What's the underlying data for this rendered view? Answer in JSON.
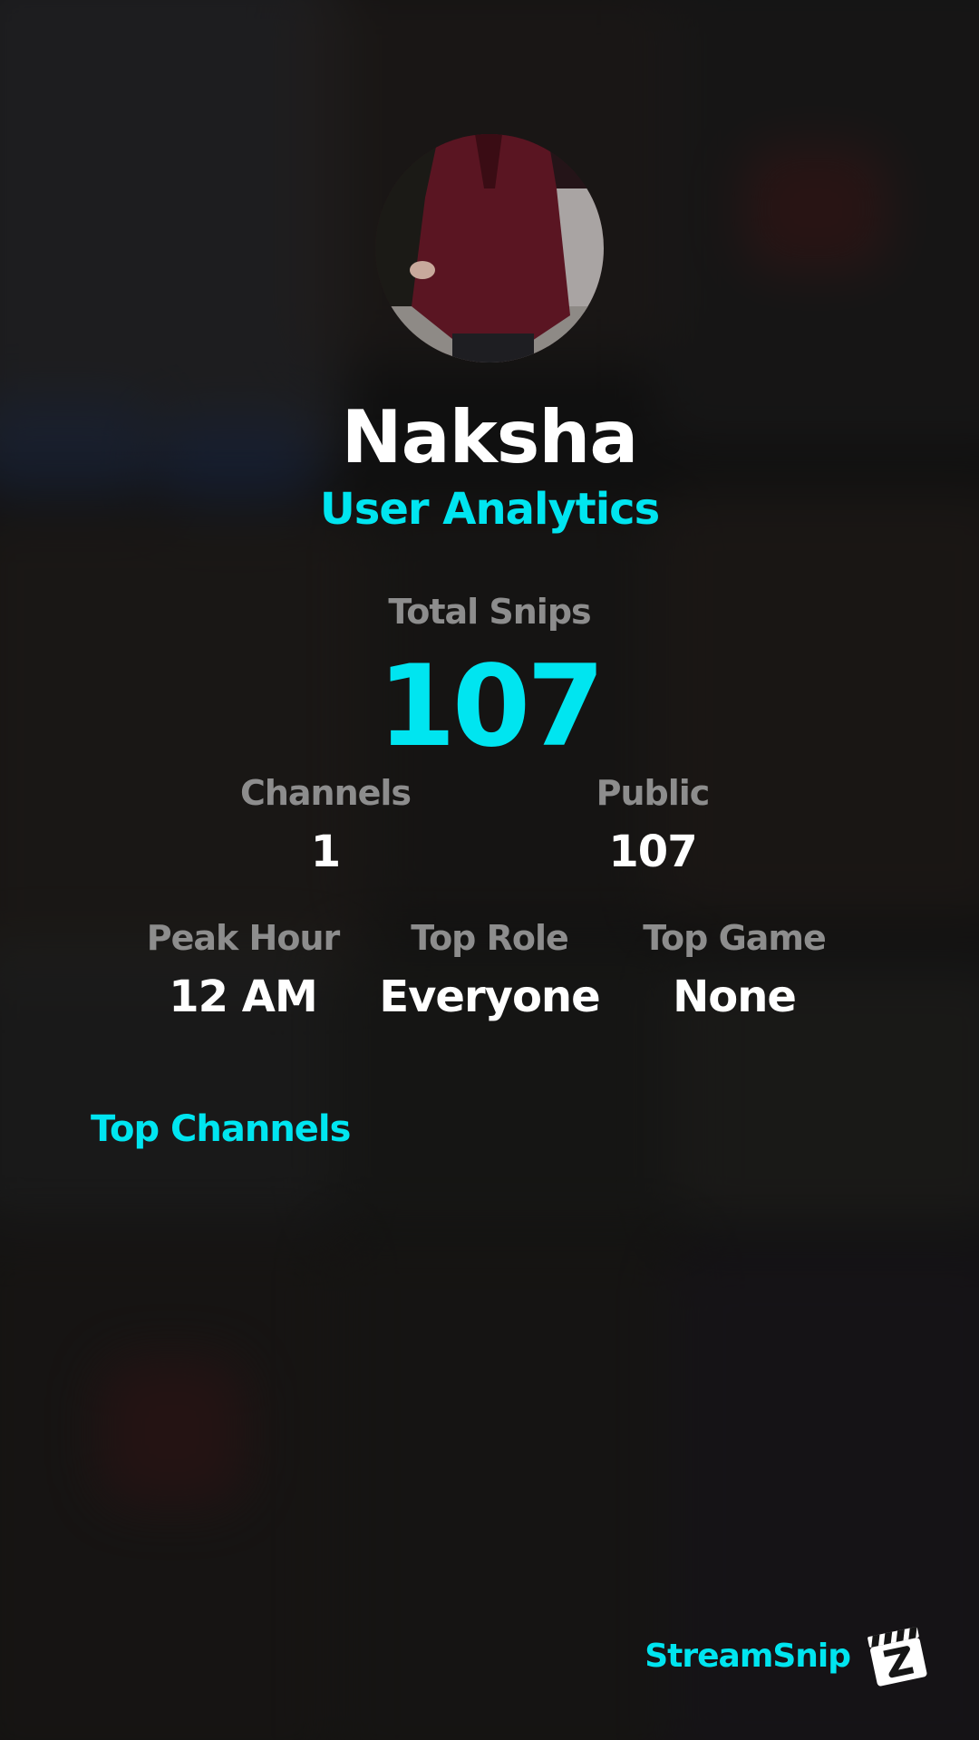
{
  "profile": {
    "username": "Naksha",
    "subtitle": "User Analytics"
  },
  "totals": {
    "total_snips_label": "Total Snips",
    "total_snips_value": "107"
  },
  "stats_row1": {
    "channels_label": "Channels",
    "channels_value": "1",
    "public_label": "Public",
    "public_value": "107"
  },
  "stats_row2": {
    "peak_hour_label": "Peak Hour",
    "peak_hour_value": "12 AM",
    "top_role_label": "Top Role",
    "top_role_value": "Everyone",
    "top_game_label": "Top Game",
    "top_game_value": "None"
  },
  "top_channels": {
    "heading": "Top Channels"
  },
  "brand": {
    "name": "StreamSnip",
    "logo_icon": "clapperboard-icon"
  },
  "colors": {
    "accent": "#00e5f0",
    "label_gray": "#8d8d8d",
    "value_white": "#ffffff",
    "background": "#151515"
  }
}
